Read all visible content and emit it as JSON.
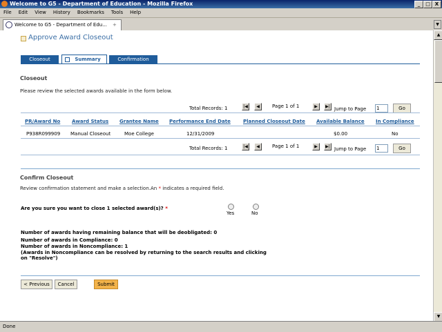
{
  "window": {
    "title": "Welcome to G5 - Department of Education - Mozilla Firefox",
    "min": "_",
    "max": "□",
    "close": "X"
  },
  "menus": [
    "File",
    "Edit",
    "View",
    "History",
    "Bookmarks",
    "Tools",
    "Help"
  ],
  "browser_tab": {
    "label": "Welcome to G5 - Department of Edu...",
    "new_tab": "+"
  },
  "page": {
    "title": "Approve Award Closeout",
    "tabs": {
      "closeout": "Closeout",
      "summary": "Summary",
      "confirmation": "Confirmation"
    },
    "closeout_heading": "Closeout",
    "closeout_note": "Please review the selected awards available in the form below.",
    "pager": {
      "total_records": "Total Records: 1",
      "page_info": "Page 1 of 1",
      "jump_label": "Jump to Page",
      "jump_value": "1",
      "go": "Go"
    },
    "table": {
      "headers": [
        "PR/Award No",
        "Award Status",
        "Grantee Name",
        "Performance End Date",
        "Planned Closeout Date",
        "Available Balance",
        "In Compliance"
      ],
      "rows": [
        [
          "P938R099909",
          "Manual Closeout",
          "Moe College",
          "12/31/2009",
          "",
          "$0.00",
          "No"
        ]
      ]
    },
    "confirm_heading": "Confirm Closeout",
    "confirm_note_pre": "Review confirmation statement and make a selection.An",
    "confirm_note_star": "*",
    "confirm_note_post": "indicates a required field.",
    "question": "Are you sure you want to close 1 selected award(s)?",
    "required_star": "*",
    "options": {
      "yes": "Yes",
      "no": "No"
    },
    "summary": {
      "balance": "Number of awards having remaining balance that will be deobligated: 0",
      "compliance": "Number of awards in Compliance: 0",
      "noncompliance": "Number of awards in Noncompliance: 1",
      "note_line1": "(Awards in Noncompliance can be resolved by returning to the search results and clicking",
      "note_line2": "on \"Resolve\")"
    },
    "buttons": {
      "previous": "< Previous",
      "cancel": "Cancel",
      "submit": "Submit"
    }
  },
  "status": "Done"
}
